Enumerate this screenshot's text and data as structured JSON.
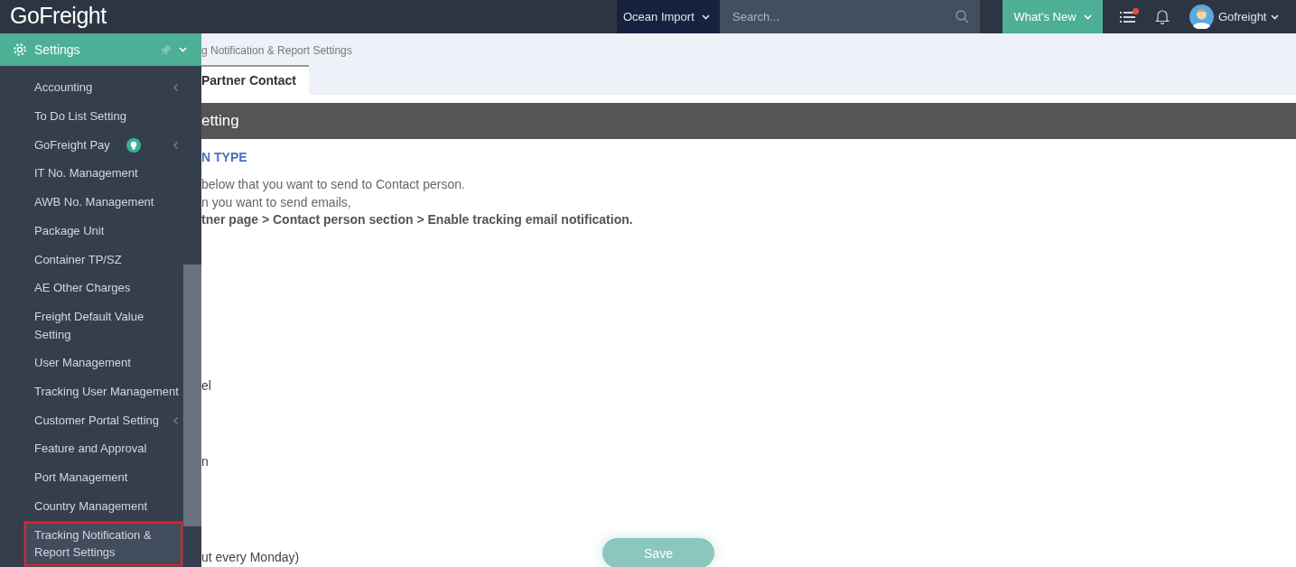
{
  "header": {
    "logo": "GoFreight",
    "module": "Ocean Import",
    "search": {
      "placeholder": "Search..."
    },
    "whats_new": "What’s New",
    "notifications": {
      "unread": true
    },
    "user": "Gofreight"
  },
  "sidebar": {
    "title": "Settings",
    "items": [
      {
        "label": "Accounting",
        "kind": "submenu",
        "selected": false
      },
      {
        "label": "To Do List Setting",
        "kind": "link",
        "selected": false
      },
      {
        "label": "GoFreight Pay",
        "kind": "submenu-badge",
        "selected": false
      },
      {
        "label": "IT No. Management",
        "kind": "link",
        "selected": false
      },
      {
        "label": "AWB No. Management",
        "kind": "link",
        "selected": false
      },
      {
        "label": "Package Unit",
        "kind": "link",
        "selected": false
      },
      {
        "label": "Container TP/SZ",
        "kind": "link",
        "selected": false
      },
      {
        "label": "AE Other Charges",
        "kind": "link",
        "selected": false
      },
      {
        "label": "Freight Default Value Setting",
        "kind": "link",
        "selected": false
      },
      {
        "label": "User Management",
        "kind": "link",
        "selected": false
      },
      {
        "label": "Tracking User Management",
        "kind": "link",
        "selected": false
      },
      {
        "label": "Customer Portal Setting",
        "kind": "submenu",
        "selected": false
      },
      {
        "label": "Feature and Approval",
        "kind": "link",
        "selected": false
      },
      {
        "label": "Port Management",
        "kind": "link",
        "selected": false
      },
      {
        "label": "Country Management",
        "kind": "link",
        "selected": false
      },
      {
        "label": "Tracking Notification & Report Settings",
        "kind": "link",
        "selected": true
      }
    ]
  },
  "breadcrumb": "g Notification & Report Settings",
  "tabs": [
    {
      "label": "Partner Contact",
      "selected": true
    }
  ],
  "section_title": "etting",
  "subheading": "N TYPE",
  "instructions": [
    {
      "text": "below that you want to send to Contact person.",
      "bold": false
    },
    {
      "text": "n you want to send emails,",
      "bold": false
    },
    {
      "text": "tner page > Contact person section > Enable tracking email notification.",
      "bold": true
    }
  ],
  "fragments": [
    "el",
    "n",
    "ut every Monday)"
  ],
  "save": "Save"
}
